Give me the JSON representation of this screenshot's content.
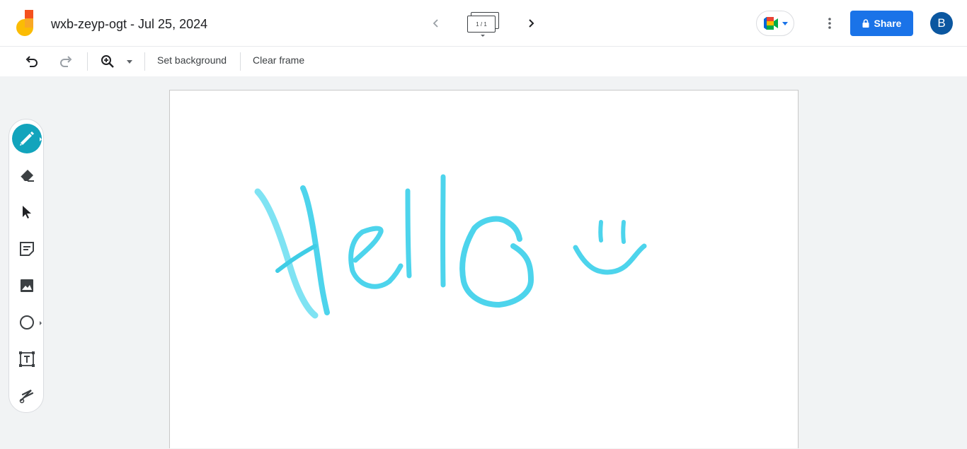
{
  "header": {
    "title": "wxb-zeyp-ogt - Jul 25, 2024",
    "frame_indicator": "1 / 1",
    "share_label": "Share",
    "avatar_initial": "B"
  },
  "toolbar": {
    "set_background": "Set background",
    "clear_frame": "Clear frame"
  },
  "palette": {
    "active_tool": "pen",
    "tools": [
      "pen",
      "eraser",
      "select",
      "sticky-note",
      "image",
      "shape",
      "text-box",
      "laser"
    ]
  },
  "canvas": {
    "ink_color": "#4dd4ec"
  },
  "colors": {
    "accent": "#1a73e8",
    "active_tool": "#12a4bc",
    "avatar": "#0b57a0"
  }
}
